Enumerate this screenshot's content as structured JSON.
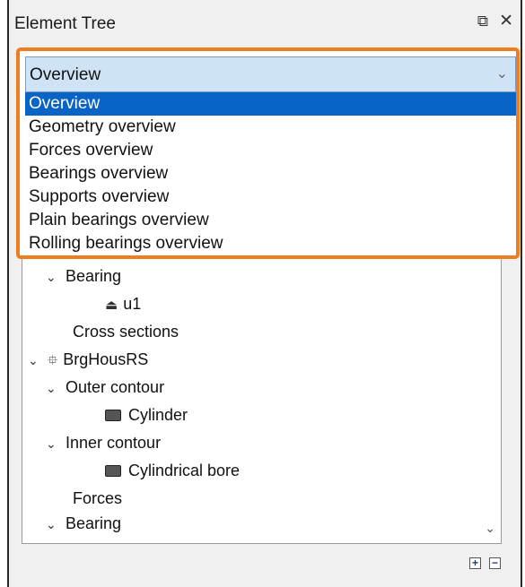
{
  "panel": {
    "title": "Element Tree",
    "dock_icon": "⧉",
    "close_icon": "✕"
  },
  "dropdown": {
    "selected": "Overview",
    "arrow": "⌄",
    "options": [
      "Overview",
      "Geometry overview",
      "Forces overview",
      "Bearings overview",
      "Supports overview",
      "Plain bearings overview",
      "Rolling bearings overview"
    ],
    "highlight_color": "#ee7d1f",
    "selected_color": "#0a63c7"
  },
  "tree": {
    "nodes": [
      {
        "label": "Bearing",
        "chevron": "⌄"
      },
      {
        "label": "u1",
        "icon": "⏏"
      },
      {
        "label": "Cross sections"
      },
      {
        "label": "BrgHousRS",
        "chevron": "⌄",
        "icon": "⯐"
      },
      {
        "label": "Outer contour",
        "chevron": "⌄"
      },
      {
        "label": "Cylinder"
      },
      {
        "label": "Inner contour",
        "chevron": "⌄"
      },
      {
        "label": "Cylindrical bore"
      },
      {
        "label": "Forces"
      },
      {
        "label": "Bearing",
        "chevron": "⌄"
      }
    ],
    "scroll_down": "⌄"
  },
  "footer": {
    "expand_label": "+",
    "collapse_label": "−"
  }
}
